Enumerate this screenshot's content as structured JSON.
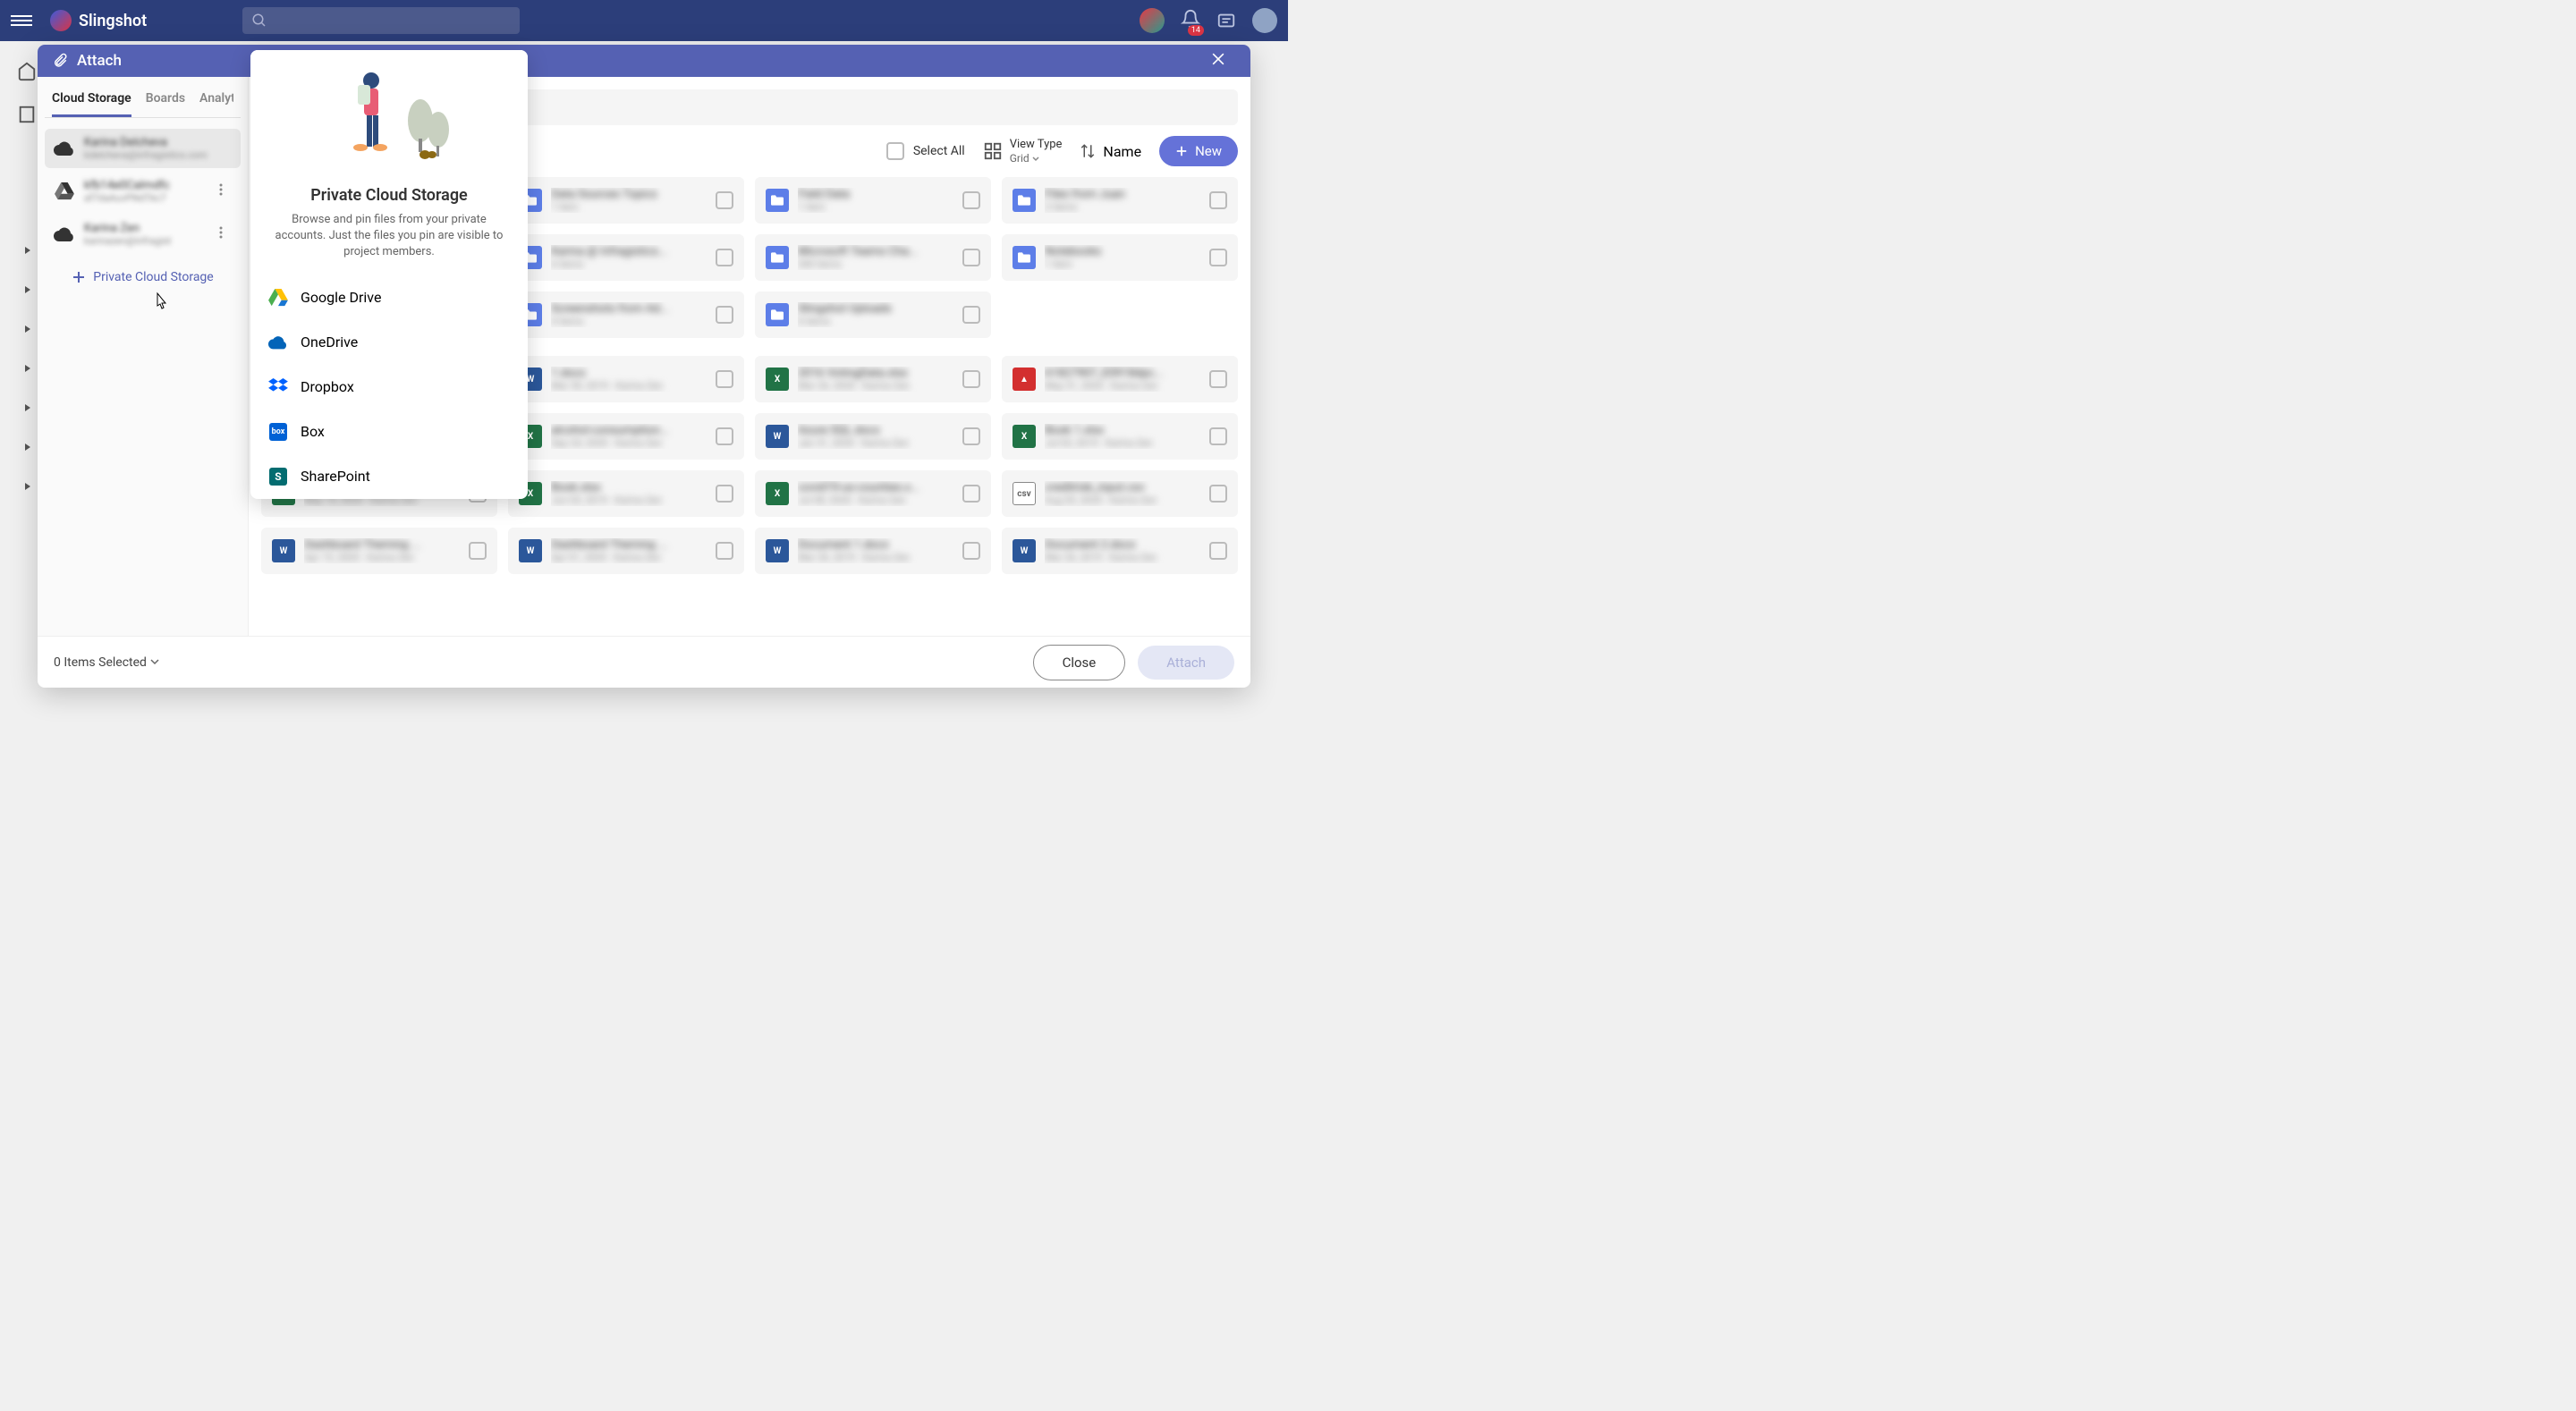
{
  "app": {
    "name": "Slingshot"
  },
  "header": {
    "notification_count": "14"
  },
  "modal": {
    "title": "Attach",
    "tabs": [
      "Cloud Storage",
      "Boards",
      "Analytics"
    ],
    "accounts": [
      {
        "name": "Karina Delcheva",
        "sub": "kdelcheva@infragistics.com",
        "provider": "onedrive"
      },
      {
        "name": "kfb14e0Calmdfc",
        "sub": "af7daAuvPNdTkc7",
        "provider": "googledrive"
      },
      {
        "name": "Karina Zen",
        "sub": "karinazen@infragist",
        "provider": "onedrive"
      }
    ],
    "add_storage_label": "Private Cloud Storage",
    "toolbar": {
      "select_all": "Select All",
      "view_type_label": "View Type",
      "view_type_value": "Grid",
      "sort_label": "Name",
      "new_label": "New"
    },
    "footer": {
      "selected_count": "0 Items Selected",
      "close_label": "Close",
      "attach_label": "Attach"
    }
  },
  "popover": {
    "title": "Private Cloud Storage",
    "description": "Browse and pin files from your private accounts. Just the files you pin are visible to project members.",
    "providers": [
      "Google Drive",
      "OneDrive",
      "Dropbox",
      "Box",
      "SharePoint"
    ]
  },
  "files": {
    "folders_row1": [
      {
        "name": "Data Sources Topics",
        "meta": "1 item"
      },
      {
        "name": "Field Data",
        "meta": "1 item"
      },
      {
        "name": "Files from Juan",
        "meta": "2 items"
      }
    ],
    "folders_row2": [
      {
        "name": "Karina @ Infragistics...",
        "meta": "6 items"
      },
      {
        "name": "Microsoft Teams Cha...",
        "meta": "540 items"
      },
      {
        "name": "Notebooks",
        "meta": "1 item"
      }
    ],
    "folders_row3": [
      {
        "name": "Screenshots from Ad...",
        "meta": "4 items"
      },
      {
        "name": "Slingshot Uploads",
        "meta": "6 items"
      }
    ],
    "files_row1": [
      {
        "name": "1.docx",
        "meta": "Mar 30, 2019 - Karina Zen",
        "type": "word"
      },
      {
        "name": "2016 VotingData.xlsx",
        "meta": "Mar 26, 2020 - Karina Zen",
        "type": "excel"
      },
      {
        "name": "61827907_E0918dpc...",
        "meta": "May 31, 2020 - Karina Zen",
        "type": "pdf"
      }
    ],
    "files_row2": [
      {
        "name": "alcohol-consumption...",
        "meta": "Sep 24, 2020 - Karina Zen",
        "type": "excel"
      },
      {
        "name": "Azure SQL.docx",
        "meta": "Jan 31, 2020 - Karina Zen",
        "type": "word"
      },
      {
        "name": "Book 1.xlsx",
        "meta": "Jul 03, 2019 - Karina Zen",
        "type": "excel"
      }
    ],
    "files_row3": [
      {
        "name": "Book 2.xlsx",
        "meta": "May 14, 2020 - Karina Zen",
        "type": "excel"
      },
      {
        "name": "Book.xlsx",
        "meta": "Jun 03, 2019 - Karina Zen",
        "type": "excel"
      },
      {
        "name": "covid19-us-counties.x...",
        "meta": "Jul 08, 2020 - Karina Zen",
        "type": "excel"
      },
      {
        "name": "creditrisk_input.csv",
        "meta": "Aug 03, 2020 - Karina Zen",
        "type": "csv"
      }
    ],
    "files_row4": [
      {
        "name": "Dashboard Theming ...",
        "meta": "Apr 15, 2020 - Karina Zen",
        "type": "word"
      },
      {
        "name": "Dashboard Theming ...",
        "meta": "Apr 01, 2020 - Karina Zen",
        "type": "word"
      },
      {
        "name": "Document 1.docx",
        "meta": "Mar 26, 2019 - Karina Zen",
        "type": "word"
      },
      {
        "name": "Document 2.docx",
        "meta": "Mar 26, 2019 - Karina Zen",
        "type": "word"
      }
    ]
  }
}
